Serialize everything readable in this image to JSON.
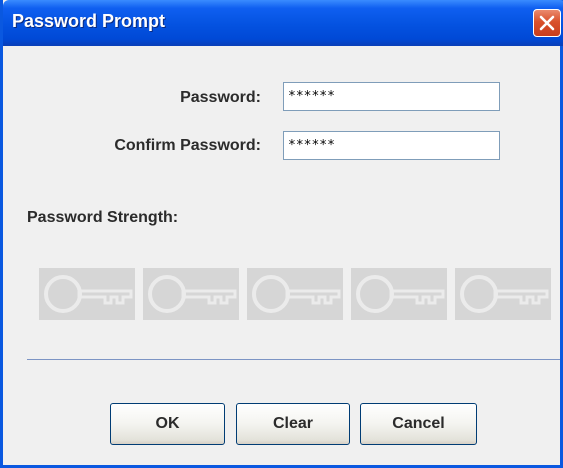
{
  "window": {
    "title": "Password Prompt"
  },
  "form": {
    "password_label": "Password:",
    "password_value": "******",
    "confirm_label": "Confirm Password:",
    "confirm_value": "******"
  },
  "strength": {
    "label": "Password Strength:",
    "indicators": [
      {
        "icon": "key-icon",
        "active": false
      },
      {
        "icon": "key-icon",
        "active": false
      },
      {
        "icon": "key-icon",
        "active": false
      },
      {
        "icon": "key-icon",
        "active": false
      },
      {
        "icon": "key-icon",
        "active": false
      }
    ]
  },
  "buttons": {
    "ok_label": "OK",
    "clear_label": "Clear",
    "cancel_label": "Cancel"
  },
  "colors": {
    "titlebar": "#0452e0",
    "close_button": "#d9512c",
    "separator": "#7c94c4",
    "inactive_indicator": "#d6d6d6"
  }
}
